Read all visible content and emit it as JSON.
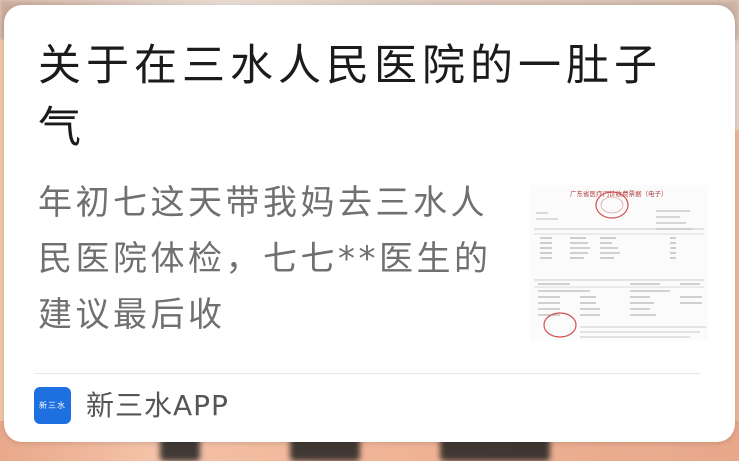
{
  "article": {
    "title": "关于在三水人民医院的一肚子气",
    "excerpt": "年初七这天带我妈去三水人民医院体检，七七**医生的建议最后收",
    "thumbnail": {
      "description": "invoice",
      "header_text": "广东省医疗门诊收费票据（电子）"
    }
  },
  "source": {
    "logo_text": "新三水",
    "name": "新三水APP",
    "brand_color": "#1e6fe0"
  }
}
